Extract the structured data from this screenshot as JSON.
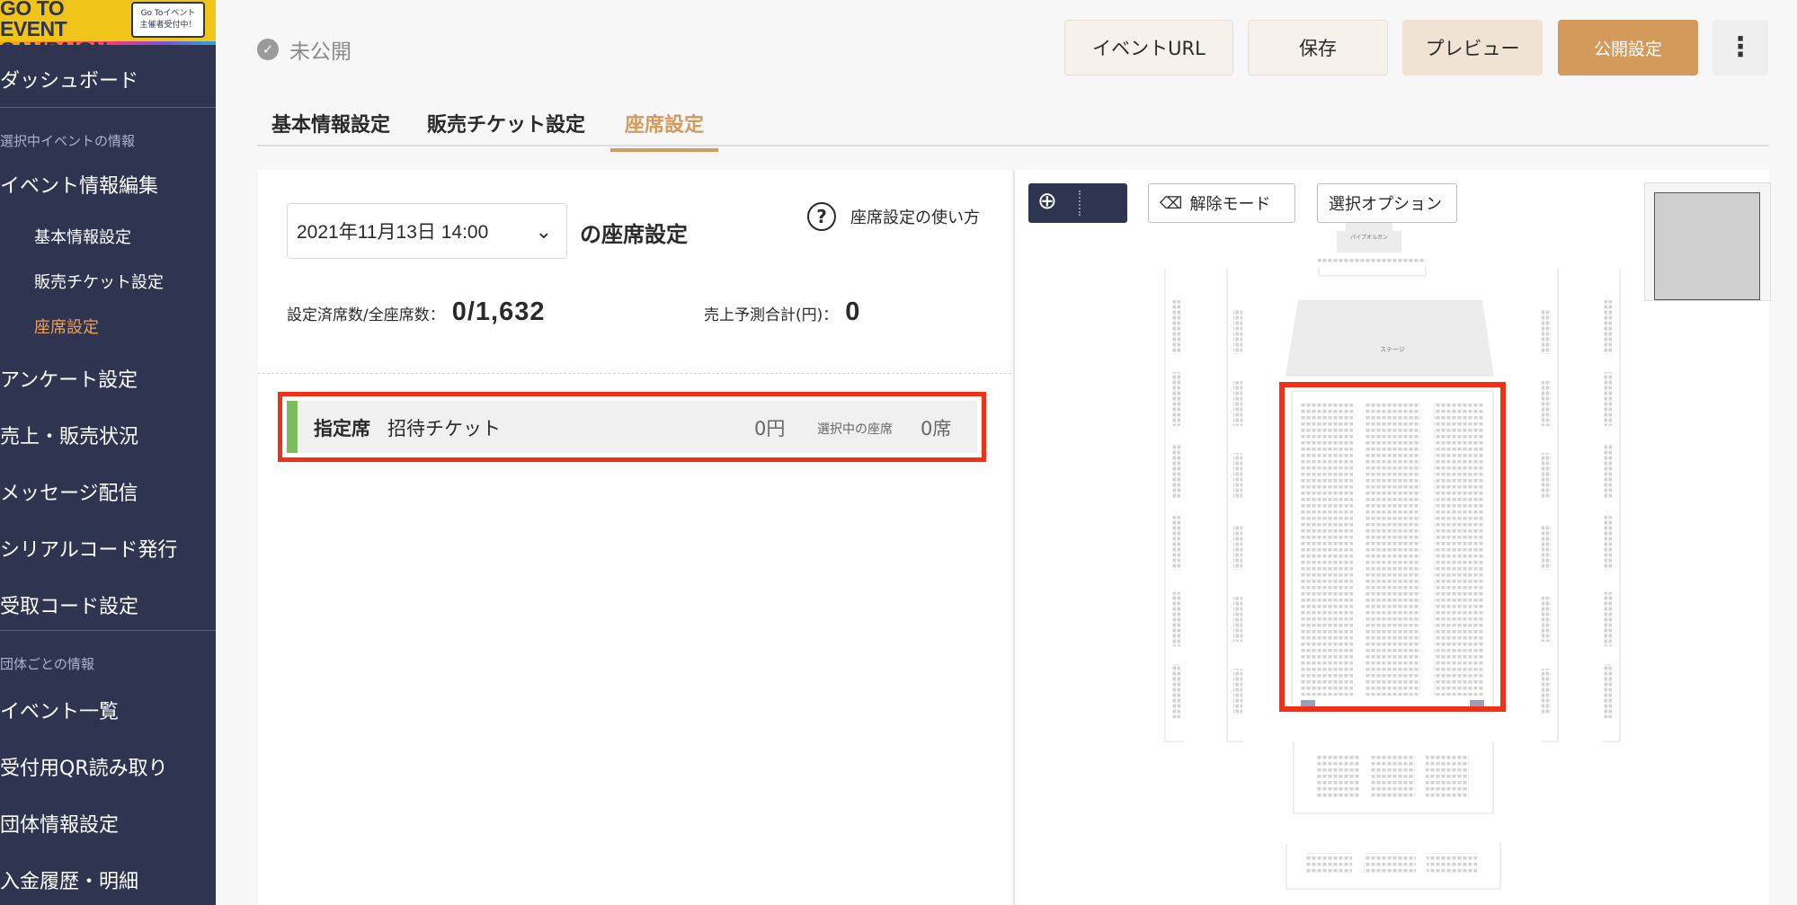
{
  "banner": {
    "title": "GO TO EVENT CAMPAIGN",
    "badge_line1": "Go Toイベント",
    "badge_line2": "主催者受付中！"
  },
  "sidebar": {
    "dashboard": "ダッシュボード",
    "section_selected_event": "選択中イベントの情報",
    "event_edit": "イベント情報編集",
    "sub_items": [
      "基本情報設定",
      "販売チケット設定",
      "座席設定"
    ],
    "more_items": [
      "アンケート設定",
      "売上・販売状況",
      "メッセージ配信",
      "シリアルコード発行",
      "受取コード設定"
    ],
    "section_group": "団体ごとの情報",
    "group_items": [
      "イベント一覧",
      "受付用QR読み取り",
      "団体情報設定",
      "入金履歴・明細"
    ]
  },
  "header": {
    "status_icon": "check-icon",
    "status": "未公開",
    "event_url": "イベントURL",
    "save": "保存",
    "preview": "プレビュー",
    "publish": "公開設定",
    "more": "⋮"
  },
  "tabs": [
    {
      "label": "基本情報設定",
      "active": false
    },
    {
      "label": "販売チケット設定",
      "active": false
    },
    {
      "label": "座席設定",
      "active": true
    }
  ],
  "seat_setting": {
    "date": "2021年11月13日 14:00",
    "title_suffix": "の座席設定",
    "help": "座席設定の使い方",
    "configured_label": "設定済席数/全座席数：",
    "configured_value": "0/1,632",
    "sales_label": "売上予測合計(円)：",
    "sales_value": "0"
  },
  "ticket": {
    "type": "指定席",
    "name": "招待チケット",
    "price": "0円",
    "selected_label": "選択中の座席",
    "selected_count": "0席"
  },
  "map_toolbar": {
    "zoom_icon": "zoom-in-icon",
    "release_mode": "解除モード",
    "eraser_icon": "eraser-icon",
    "select_option": "選択オプション"
  },
  "seatmap_labels": {
    "organ": "パイプオルガン",
    "stage": "ステージ"
  },
  "colors": {
    "sidebar_bg": "#2f3450",
    "accent": "#d49a5c",
    "highlight": "#f23018",
    "ticket_bar": "#7cbd5a"
  }
}
